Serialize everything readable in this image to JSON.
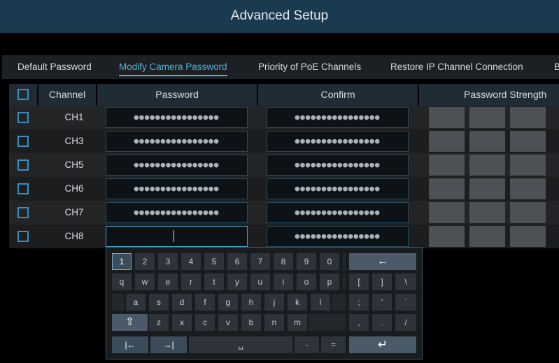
{
  "header": {
    "title": "Advanced Setup"
  },
  "tabs": [
    {
      "label": "Default Password",
      "active": false
    },
    {
      "label": "Modify Camera Password",
      "active": true
    },
    {
      "label": "Priority of PoE Channels",
      "active": false
    },
    {
      "label": "Restore IP Channel Connection",
      "active": false
    },
    {
      "label": "B",
      "active": false
    }
  ],
  "table": {
    "columns": {
      "channel": "Channel",
      "password": "Password",
      "confirm": "Confirm",
      "strength": "Password Strength"
    },
    "rows": [
      {
        "channel": "CH1",
        "password": "●●●●●●●●●●●●●●●●",
        "confirm": "●●●●●●●●●●●●●●●●"
      },
      {
        "channel": "CH3",
        "password": "●●●●●●●●●●●●●●●●",
        "confirm": "●●●●●●●●●●●●●●●●"
      },
      {
        "channel": "CH5",
        "password": "●●●●●●●●●●●●●●●●",
        "confirm": "●●●●●●●●●●●●●●●●"
      },
      {
        "channel": "CH6",
        "password": "●●●●●●●●●●●●●●●●",
        "confirm": "●●●●●●●●●●●●●●●●"
      },
      {
        "channel": "CH7",
        "password": "●●●●●●●●●●●●●●●●",
        "confirm": "●●●●●●●●●●●●●●●●"
      },
      {
        "channel": "CH8",
        "password": "",
        "confirm": "●●●●●●●●●●●●●●●●"
      }
    ]
  },
  "keyboard": {
    "row1": [
      "1",
      "2",
      "3",
      "4",
      "5",
      "6",
      "7",
      "8",
      "9",
      "0"
    ],
    "row2": [
      "q",
      "w",
      "e",
      "r",
      "t",
      "y",
      "u",
      "i",
      "o",
      "p",
      "[",
      "]",
      "\\"
    ],
    "row3": [
      "a",
      "s",
      "d",
      "f",
      "g",
      "h",
      "j",
      "k",
      "l",
      ";",
      "'",
      "`"
    ],
    "row4": [
      "z",
      "x",
      "c",
      "v",
      "b",
      "n",
      "m",
      ",",
      ".",
      "/"
    ],
    "backspace": "←",
    "shift": "⇧",
    "tab_left": "|←",
    "tab_right": "→|",
    "space": "␣",
    "minus": "-",
    "equals": "=",
    "enter": "↵"
  },
  "colors": {
    "accent": "#4fb3d9",
    "title_bar": "#1a3a50",
    "strength_empty": "#4d5054"
  }
}
